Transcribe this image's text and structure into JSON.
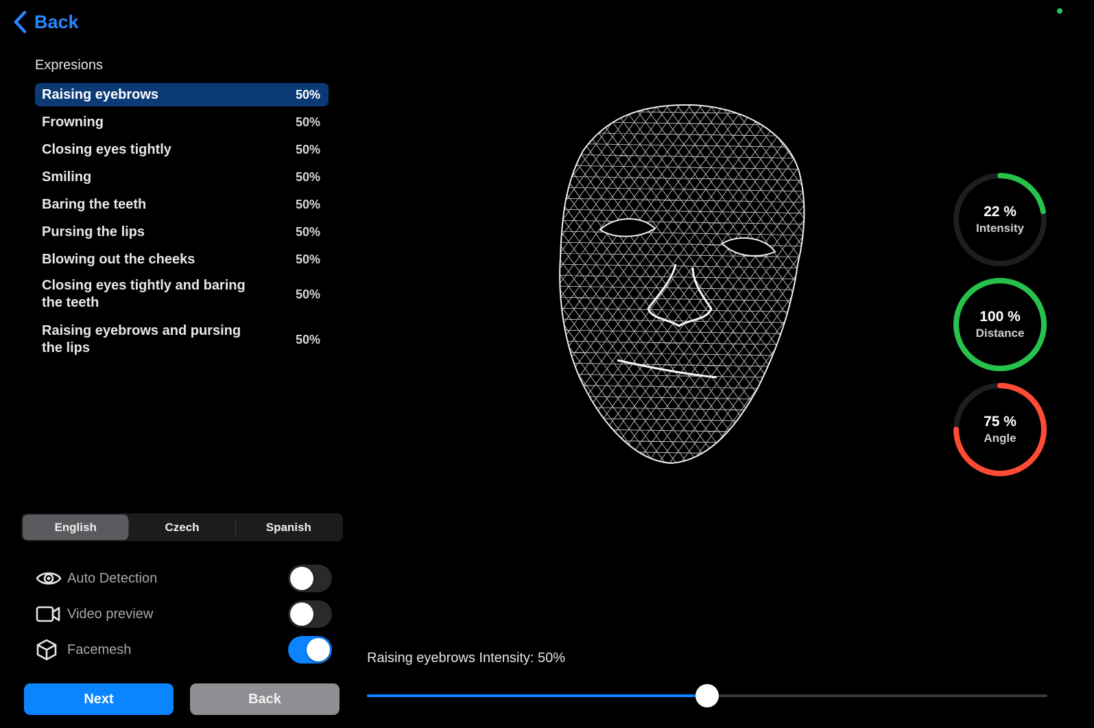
{
  "header": {
    "back_label": "Back"
  },
  "status": {
    "dot_color": "#23c55e"
  },
  "expressions": {
    "title": "Expresions",
    "selected_bg": "#0b3a75",
    "items": [
      {
        "name": "Raising eyebrows",
        "value": "50%",
        "selected": true
      },
      {
        "name": "Frowning",
        "value": "50%",
        "selected": false
      },
      {
        "name": "Closing eyes tightly",
        "value": "50%",
        "selected": false
      },
      {
        "name": "Smiling",
        "value": "50%",
        "selected": false
      },
      {
        "name": "Baring the teeth",
        "value": "50%",
        "selected": false
      },
      {
        "name": "Pursing the lips",
        "value": "50%",
        "selected": false
      },
      {
        "name": "Blowing out the cheeks",
        "value": "50%",
        "selected": false
      },
      {
        "name": "Closing eyes tightly and baring the teeth",
        "value": "50%",
        "selected": false
      },
      {
        "name": "Raising eyebrows and pursing the lips",
        "value": "50%",
        "selected": false
      }
    ]
  },
  "language": {
    "options": [
      "English",
      "Czech",
      "Spanish"
    ],
    "selected": "English"
  },
  "settings": [
    {
      "label": "Auto Detection",
      "icon": "eye-icon",
      "enabled": false
    },
    {
      "label": "Video preview",
      "icon": "video-camera-icon",
      "enabled": false
    },
    {
      "label": "Facemesh",
      "icon": "cube-icon",
      "enabled": true
    }
  ],
  "buttons": {
    "next_label": "Next",
    "back_label": "Back"
  },
  "metrics": [
    {
      "value": "22 %",
      "label": "Intensity",
      "percent": 22,
      "color": "#27c24c"
    },
    {
      "value": "100 %",
      "label": "Distance",
      "percent": 100,
      "color": "#27c24c"
    },
    {
      "value": "75 %",
      "label": "Angle",
      "percent": 75,
      "color": "#ff4b33"
    }
  ],
  "slider": {
    "label": "Raising eyebrows Intensity: 50%",
    "value": 50,
    "fill_color": "#0a84ff"
  },
  "accent_color": "#0a84ff"
}
